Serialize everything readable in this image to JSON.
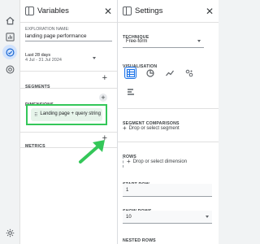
{
  "variables": {
    "title": "Variables",
    "exploration_name_label": "EXPLORATION NAME:",
    "exploration_name_value": "landing page performance",
    "date_range_label": "Last 28 days",
    "date_range_value": "4 Jul - 31 Jul 2024",
    "segments_label": "SEGMENTS",
    "dimensions_label": "DIMENSIONS",
    "dimension_chip": "Landing page + query string",
    "metrics_label": "METRICS"
  },
  "settings": {
    "title": "Settings",
    "technique_label": "TECHNIQUE",
    "technique_value": "Free-form",
    "visualisation_label": "VISUALISATION",
    "segment_comparisons_label": "SEGMENT COMPARISONS",
    "segment_drop_text": "Drop or select segment",
    "rows_label": "ROWS",
    "dimension_drop_text": "Drop or select dimension",
    "start_row_label": "START ROW",
    "start_row_value": "1",
    "show_rows_label": "SHOW ROWS",
    "show_rows_value": "10",
    "nested_rows_label": "NESTED ROWS"
  },
  "colors": {
    "highlight": "#34c759",
    "accent": "#1a73e8",
    "chip_bg": "#e6f4ea"
  },
  "icons": [
    "home-icon",
    "reports-icon",
    "explore-icon",
    "advertising-icon",
    "settings-gear-icon",
    "collapse-panel-icon",
    "close-icon",
    "table-icon",
    "donut-icon",
    "line-chart-icon",
    "scatter-icon",
    "bar-icon",
    "arrow-annotation-icon"
  ]
}
